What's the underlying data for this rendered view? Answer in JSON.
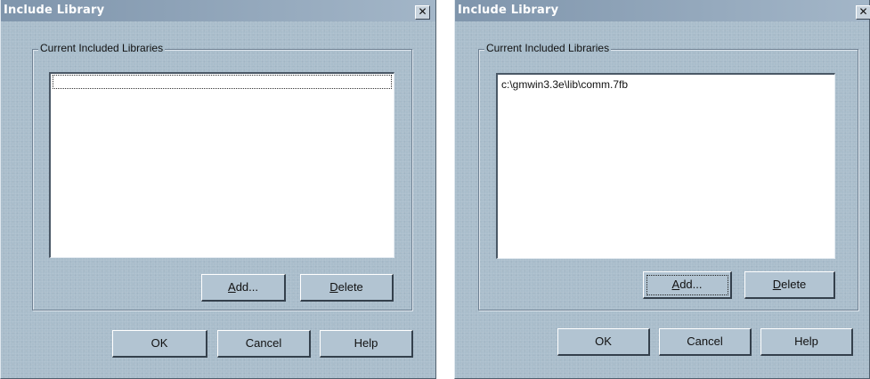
{
  "dialogs": [
    {
      "title": "Include Library",
      "close_symbol": "✕",
      "group_label": "Current Included Libraries",
      "library_list": [],
      "add_button": {
        "mnemonic": "A",
        "rest": "dd..."
      },
      "delete_button": {
        "mnemonic": "D",
        "rest": "elete"
      },
      "ok_label": "OK",
      "cancel_label": "Cancel",
      "help_label": "Help"
    },
    {
      "title": "Include Library",
      "close_symbol": "✕",
      "group_label": "Current Included Libraries",
      "library_list": [
        "c:\\gmwin3.3e\\lib\\comm.7fb"
      ],
      "add_button": {
        "mnemonic": "A",
        "rest": "dd..."
      },
      "delete_button": {
        "mnemonic": "D",
        "rest": "elete"
      },
      "ok_label": "OK",
      "cancel_label": "Cancel",
      "help_label": "Help"
    }
  ],
  "icons": {
    "close": "close-icon"
  },
  "colors": {
    "dialog_face": "#a9bdcb",
    "title_bar": "#7f95ac",
    "list_background": "#ffffff"
  }
}
